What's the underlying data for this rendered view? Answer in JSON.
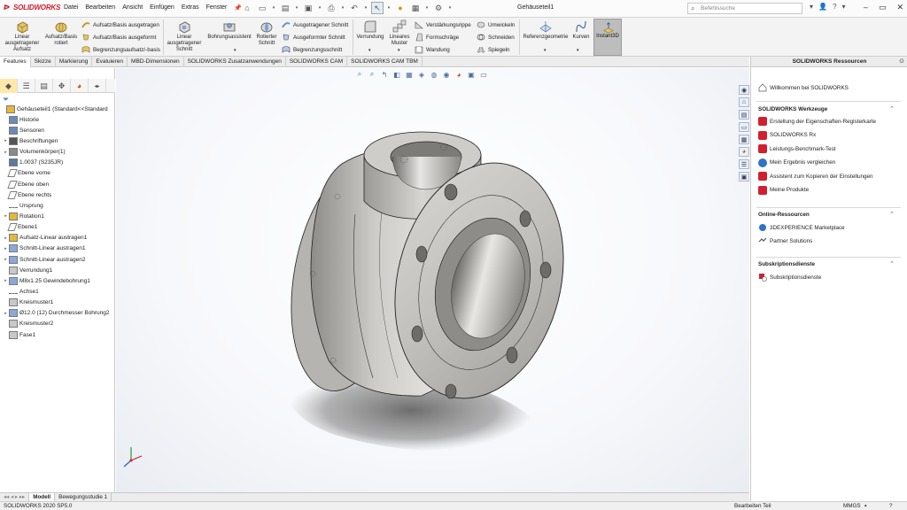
{
  "app": {
    "logo": "SOLIDWORKS",
    "document_title": "Gehäuseteil1",
    "search_placeholder": "Befehlssuche"
  },
  "menu": [
    "Datei",
    "Bearbeiten",
    "Ansicht",
    "Einfügen",
    "Extras",
    "Fenster"
  ],
  "ribbon": {
    "linear_boss": "Linear ausgetragener Aufsatz",
    "revolve_boss": "Aufsatz/Basis rotiert",
    "swept_boss": "Aufsatz/Basis ausgetragen",
    "lofted_boss": "Aufsatz/Basis ausgeformt",
    "boundary_boss": "Begrenzungsaufsatz/-basis",
    "extruded_cut": "Linear ausgetragener Schnitt",
    "hole_wizard": "Bohrungsassistent",
    "revolved_cut": "Rotierter Schnitt",
    "swept_cut": "Ausgetragener Schnitt",
    "lofted_cut": "Ausgeformter Schnitt",
    "boundary_cut": "Begrenzungsschnitt",
    "fillet": "Verrundung",
    "linear_pattern": "Lineares Muster",
    "rib": "Verstärkungsrippe",
    "draft": "Formschräge",
    "shell": "Wandung",
    "wrap": "Umwickeln",
    "intersect": "Schneiden",
    "mirror": "Spiegeln",
    "ref_geometry": "Referenzgeometrie",
    "curves": "Kurven",
    "instant3d": "Instant3D"
  },
  "tabs": [
    "Features",
    "Skizze",
    "Markierung",
    "Evaluieren",
    "MBD-Dimensionen",
    "SOLIDWORKS Zusatzanwendungen",
    "SOLIDWORKS CAM",
    "SOLIDWORKS CAM TBM"
  ],
  "tree": [
    {
      "label": "Gehäuseteil1  (Standard<<Standard",
      "exp": "",
      "indent": 0,
      "icon": "part"
    },
    {
      "label": "Historie",
      "exp": "",
      "indent": 1,
      "icon": "history"
    },
    {
      "label": "Sensoren",
      "exp": "",
      "indent": 1,
      "icon": "sensor"
    },
    {
      "label": "Beschriftungen",
      "exp": "▸",
      "indent": 1,
      "icon": "annotation"
    },
    {
      "label": "Volumenkörper(1)",
      "exp": "▸",
      "indent": 1,
      "icon": "solid"
    },
    {
      "label": "1.0037 (S235JR)",
      "exp": "",
      "indent": 1,
      "icon": "material"
    },
    {
      "label": "Ebene vorne",
      "exp": "",
      "indent": 1,
      "icon": "plane"
    },
    {
      "label": "Ebene oben",
      "exp": "",
      "indent": 1,
      "icon": "plane"
    },
    {
      "label": "Ebene rechts",
      "exp": "",
      "indent": 1,
      "icon": "plane"
    },
    {
      "label": "Ursprung",
      "exp": "",
      "indent": 1,
      "icon": "origin"
    },
    {
      "label": "Rotation1",
      "exp": "▸",
      "indent": 1,
      "icon": "revolve"
    },
    {
      "label": "Ebene1",
      "exp": "",
      "indent": 1,
      "icon": "plane"
    },
    {
      "label": "Aufsatz-Linear austragen1",
      "exp": "▸",
      "indent": 1,
      "icon": "extrude"
    },
    {
      "label": "Schnitt-Linear austragen1",
      "exp": "▸",
      "indent": 1,
      "icon": "cut"
    },
    {
      "label": "Schnitt-Linear austragen2",
      "exp": "▸",
      "indent": 1,
      "icon": "cut"
    },
    {
      "label": "Verrundung1",
      "exp": "",
      "indent": 1,
      "icon": "fillet"
    },
    {
      "label": "M8x1.25 Gewindebohrung1",
      "exp": "▸",
      "indent": 1,
      "icon": "hole"
    },
    {
      "label": "Achse1",
      "exp": "",
      "indent": 1,
      "icon": "axis"
    },
    {
      "label": "Kreismuster1",
      "exp": "",
      "indent": 1,
      "icon": "pattern"
    },
    {
      "label": "Ø12.0 (12) Durchmesser Bohrung2",
      "exp": "▸",
      "indent": 1,
      "icon": "hole"
    },
    {
      "label": "Kreismuster2",
      "exp": "",
      "indent": 1,
      "icon": "pattern"
    },
    {
      "label": "Fase1",
      "exp": "",
      "indent": 1,
      "icon": "chamfer"
    }
  ],
  "bottom_tabs": [
    "Modell",
    "Bewegungsstudie 1"
  ],
  "status": {
    "version": "SOLIDWORKS 2020 SP5.0",
    "mode": "Bearbeiten Teil",
    "units": "MMGS"
  },
  "taskpane": {
    "title": "SOLIDWORKS Ressourcen",
    "welcome": "Willkommen bei SOLIDWORKS",
    "tools_header": "SOLIDWORKS Werkzeuge",
    "tools": [
      "Erstellung der Eigenschaften-Registerkarte",
      "SOLIDWORKS Rx",
      "Leistungs-Benchmark-Test",
      "Mein Ergebnis vergleichen",
      "Assistent zum Kopieren der Einstellungen",
      "Meine Produkte"
    ],
    "online_header": "Online-Ressourcen",
    "online": [
      "3DEXPERIENCE Marketplace",
      "Partner Solutions"
    ],
    "subs_header": "Subskriptionsdienste",
    "subs": [
      "Subskriptionsdienste"
    ]
  },
  "colors": {
    "brand_red": "#d0202f",
    "accent_blue": "#4a6ea0",
    "part_metal": "#b3b1ae"
  }
}
